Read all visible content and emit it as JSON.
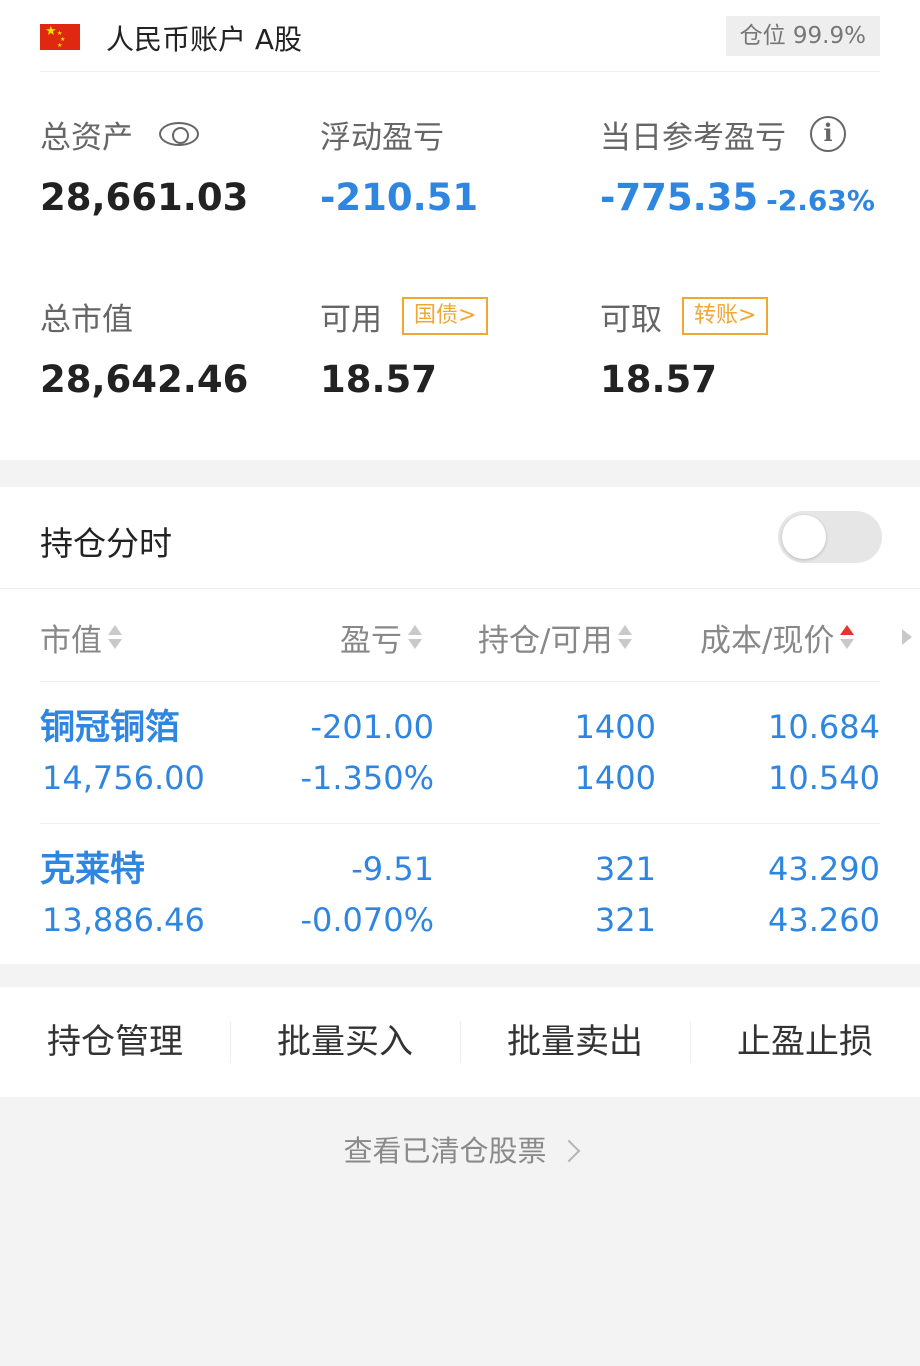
{
  "account": {
    "title": "人民币账户 A股",
    "position_ratio": "仓位 99.9%",
    "total_assets": {
      "label": "总资产",
      "value": "28,661.03"
    },
    "floating_pnl": {
      "label": "浮动盈亏",
      "value": "-210.51"
    },
    "daily_pnl": {
      "label": "当日参考盈亏",
      "value": "-775.35",
      "pct": "-2.63%"
    },
    "market_value": {
      "label": "总市值",
      "value": "28,642.46"
    },
    "available": {
      "label": "可用",
      "value": "18.57",
      "tag": "国债>"
    },
    "withdrawable": {
      "label": "可取",
      "value": "18.57",
      "tag": "转账>"
    }
  },
  "positions": {
    "title": "持仓分时",
    "toggle_on": false,
    "headers": [
      "市值",
      "盈亏",
      "持仓/可用",
      "成本/现价"
    ],
    "rows": [
      {
        "name": "铜冠铜箔",
        "market_value": "14,756.00",
        "pnl": "-201.00",
        "pnl_pct": "-1.350%",
        "holding": "1400",
        "available": "1400",
        "cost": "10.684",
        "price": "10.540"
      },
      {
        "name": "克莱特",
        "market_value": "13,886.46",
        "pnl": "-9.51",
        "pnl_pct": "-0.070%",
        "holding": "321",
        "available": "321",
        "cost": "43.290",
        "price": "43.260"
      }
    ]
  },
  "actions": [
    "持仓管理",
    "批量买入",
    "批量卖出",
    "止盈止损"
  ],
  "cleared_link": "查看已清仓股票",
  "colors": {
    "accent_blue": "#2f86e0",
    "tag_orange": "#f0a733",
    "sort_active_red": "#e5342c"
  }
}
